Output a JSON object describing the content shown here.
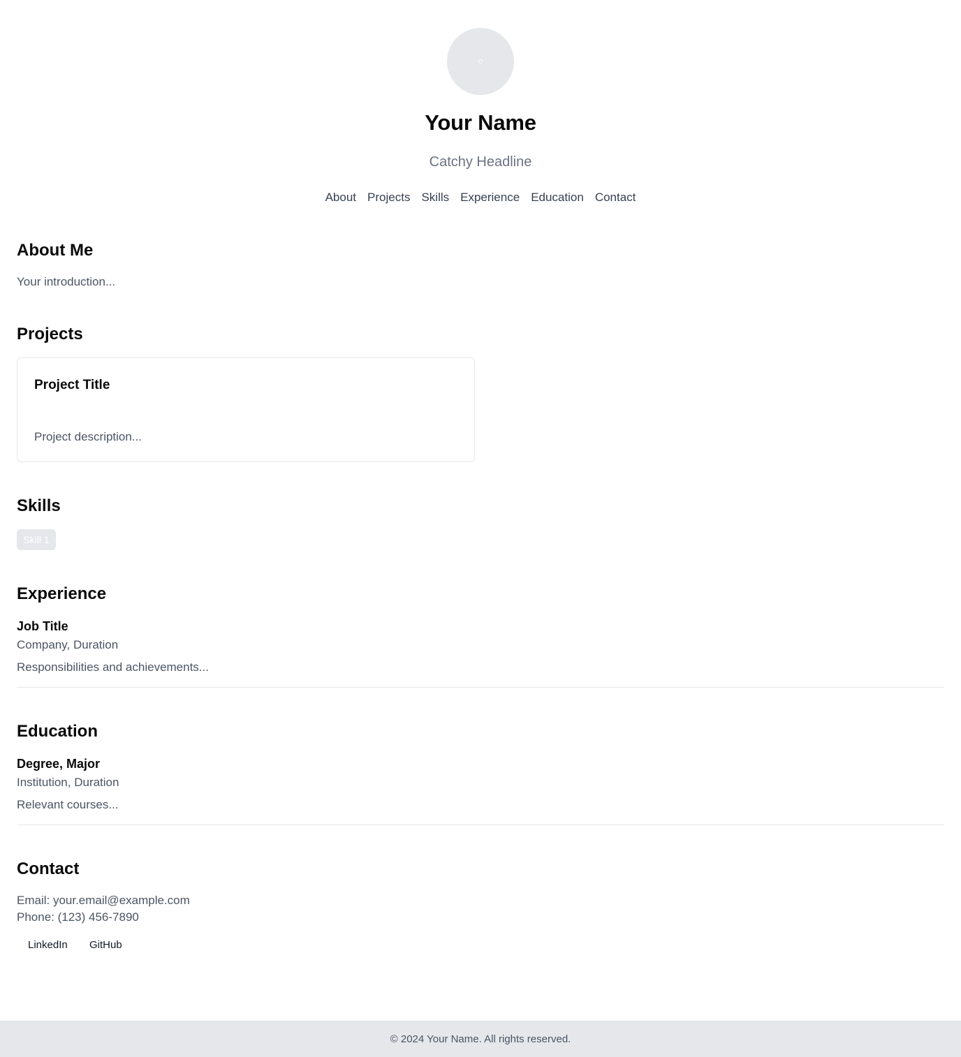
{
  "header": {
    "name": "Your Name",
    "headline": "Catchy Headline",
    "nav": [
      "About",
      "Projects",
      "Skills",
      "Experience",
      "Education",
      "Contact"
    ]
  },
  "about": {
    "title": "About Me",
    "text": "Your introduction..."
  },
  "projects": {
    "title": "Projects",
    "items": [
      {
        "title": "Project Title",
        "description": "Project description..."
      }
    ]
  },
  "skills": {
    "title": "Skills",
    "items": [
      "Skill 1"
    ]
  },
  "experience": {
    "title": "Experience",
    "items": [
      {
        "job_title": "Job Title",
        "meta": "Company, Duration",
        "details": "Responsibilities and achievements..."
      }
    ]
  },
  "education": {
    "title": "Education",
    "items": [
      {
        "degree": "Degree, Major",
        "meta": "Institution, Duration",
        "details": "Relevant courses..."
      }
    ]
  },
  "contact": {
    "title": "Contact",
    "email": "Email: your.email@example.com",
    "phone": "Phone: (123) 456-7890",
    "links": [
      "LinkedIn",
      "GitHub"
    ]
  },
  "footer": {
    "text": "© 2024 Your Name. All rights reserved."
  },
  "colors": {
    "avatar_bg": "#e5e7eb",
    "muted_text": "#4b5563",
    "footer_bg": "#e5e7eb",
    "border": "#e5e7eb"
  }
}
